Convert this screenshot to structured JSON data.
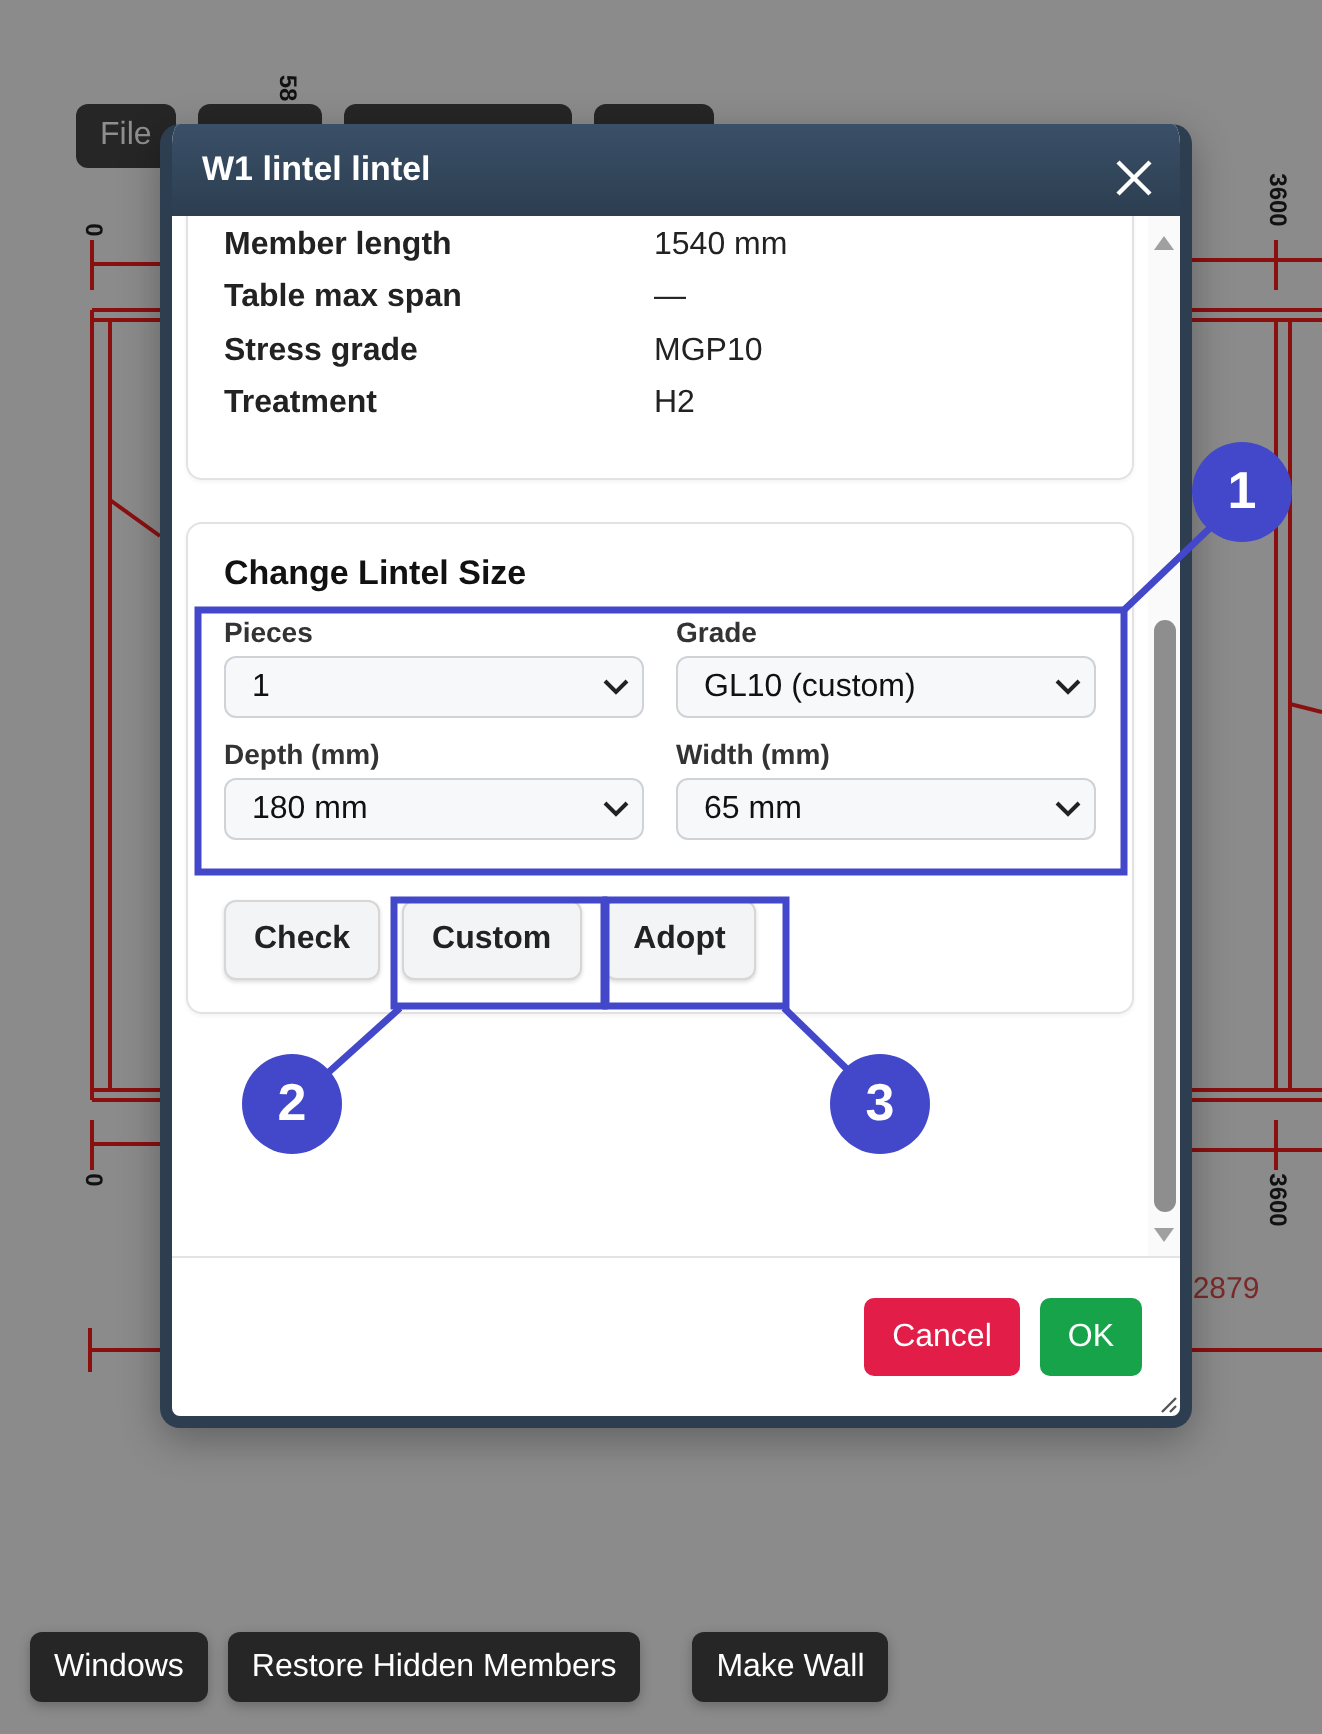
{
  "toolbar": [
    {
      "kind": "button",
      "label": "File"
    },
    {
      "kind": "covered"
    },
    {
      "kind": "covered"
    },
    {
      "kind": "covered"
    }
  ],
  "dimension_labels": [
    "58",
    "0",
    "3600",
    "0",
    "3600",
    "2879"
  ],
  "dialog": {
    "title": "W1 lintel lintel",
    "details": [
      {
        "label": "Member length",
        "value": "1540 mm"
      },
      {
        "label": "Table max span",
        "value": "—"
      },
      {
        "label": "Stress grade",
        "value": "MGP10"
      },
      {
        "label": "Treatment",
        "value": "H2"
      }
    ],
    "change_size": {
      "title": "Change Lintel Size",
      "fields": [
        {
          "label": "Pieces",
          "value": "1"
        },
        {
          "label": "Grade",
          "value": "GL10 (custom)"
        },
        {
          "label": "Depth (mm)",
          "value": "180 mm"
        },
        {
          "label": "Width (mm)",
          "value": "65 mm"
        }
      ],
      "buttons": [
        "Check",
        "Custom",
        "Adopt"
      ]
    },
    "footer_buttons": [
      {
        "kind": "cancel",
        "label": "Cancel"
      },
      {
        "kind": "ok",
        "label": "OK"
      }
    ]
  },
  "callouts": [
    "1",
    "2",
    "3"
  ],
  "bottom_toolbar": [
    "Windows",
    "Restore Hidden Members",
    "Make Wall"
  ]
}
